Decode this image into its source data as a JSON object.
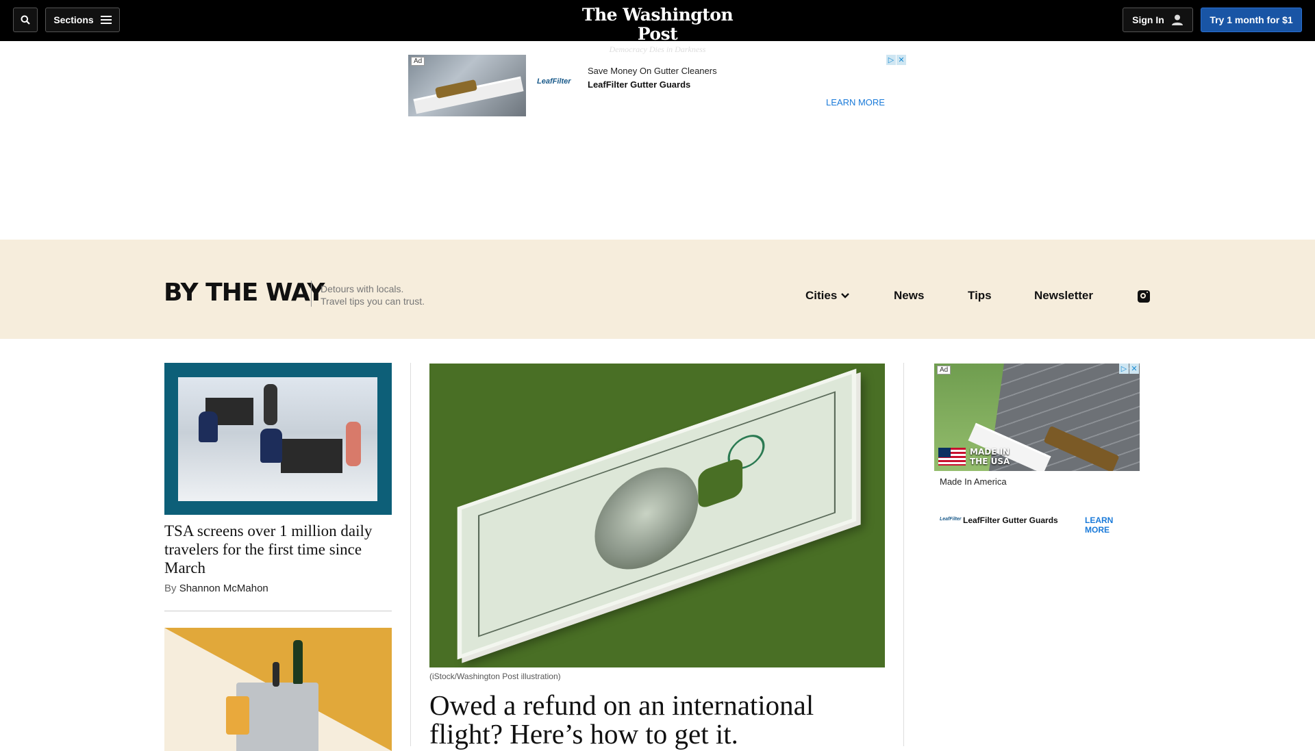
{
  "header": {
    "sections_label": "Sections",
    "logo": "The Washington Post",
    "tagline": "Democracy Dies in Darkness",
    "signin_label": "Sign In",
    "subscribe_label": "Try 1 month for $1"
  },
  "top_ad": {
    "badge": "Ad",
    "brand": "LeafFilter",
    "headline": "Save Money On Gutter Cleaners",
    "advertiser": "LeafFilter Gutter Guards",
    "cta": "LEARN MORE"
  },
  "btw": {
    "logo": "BY THE WAY",
    "tagline_1": "Detours with locals.",
    "tagline_2": "Travel tips you can trust.",
    "nav": [
      "Cities",
      "News",
      "Tips",
      "Newsletter"
    ]
  },
  "left_story": {
    "headline": "TSA screens over 1 million daily travelers for the first time since March",
    "byline_prefix": "By",
    "author": "Shannon McMahon"
  },
  "main_story": {
    "caption": "(iStock/Washington Post illustration)",
    "headline": "Owed a refund on an international flight? Here’s how to get it."
  },
  "side_ad": {
    "badge": "Ad",
    "made_line_1": "MADE IN",
    "made_line_2": "THE USA",
    "sub": "Made In America",
    "brand": "LeafFilter",
    "advertiser": "LeafFilter Gutter Guards",
    "cta": "LEARN MORE"
  },
  "colors": {
    "topbar": "#000000",
    "subscribe": "#1955a5",
    "band": "#f6eddc",
    "hero_bg": "#496f25",
    "link": "#1a7ad9"
  }
}
